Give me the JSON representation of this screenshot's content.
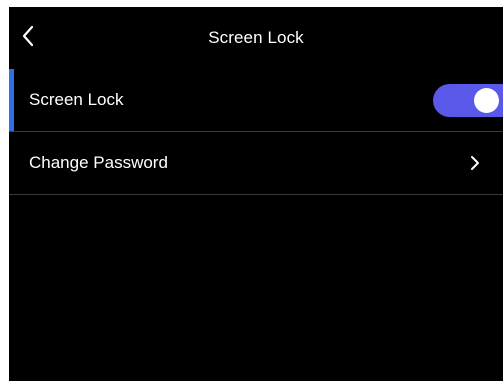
{
  "header": {
    "title": "Screen Lock",
    "back_icon": "chevron-left-icon"
  },
  "settings": {
    "items": [
      {
        "label": "Screen Lock",
        "control": "toggle",
        "enabled": true,
        "selected": true
      },
      {
        "label": "Change Password",
        "control": "chevron",
        "icon": "chevron-right-icon"
      }
    ]
  },
  "colors": {
    "background": "#000000",
    "accent_bar": "#2f6fe8",
    "toggle_on": "#5a58e8",
    "divider": "#3a3a3a",
    "text": "#ffffff"
  }
}
